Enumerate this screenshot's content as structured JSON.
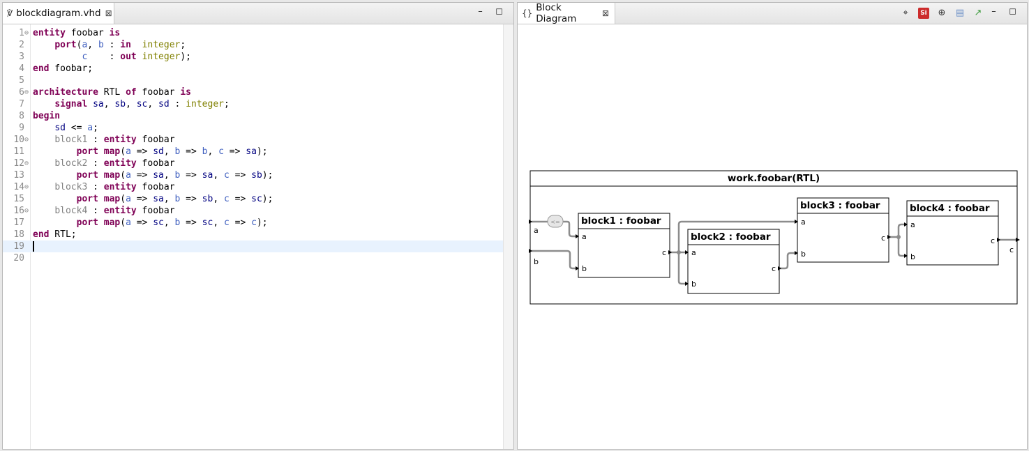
{
  "editor": {
    "tab_title": "blockdiagram.vhd",
    "code_lines": [
      {
        "n": "1",
        "fold": true,
        "parts": [
          [
            "kw",
            "entity"
          ],
          [
            "t",
            " foobar "
          ],
          [
            "kw",
            "is"
          ]
        ]
      },
      {
        "n": "2",
        "parts": [
          [
            "t",
            "    "
          ],
          [
            "kw",
            "port"
          ],
          [
            "t",
            "("
          ],
          [
            "prt",
            "a"
          ],
          [
            "t",
            ", "
          ],
          [
            "prt",
            "b"
          ],
          [
            "t",
            " : "
          ],
          [
            "kw",
            "in"
          ],
          [
            "t",
            "  "
          ],
          [
            "typ",
            "integer"
          ],
          [
            "t",
            ";"
          ]
        ]
      },
      {
        "n": "3",
        "parts": [
          [
            "t",
            "         "
          ],
          [
            "prt",
            "c"
          ],
          [
            "t",
            "    : "
          ],
          [
            "kw",
            "out"
          ],
          [
            "t",
            " "
          ],
          [
            "typ",
            "integer"
          ],
          [
            "t",
            ");"
          ]
        ]
      },
      {
        "n": "4",
        "parts": [
          [
            "kw",
            "end"
          ],
          [
            "t",
            " foobar;"
          ]
        ]
      },
      {
        "n": "5",
        "parts": []
      },
      {
        "n": "6",
        "fold": true,
        "parts": [
          [
            "kw",
            "architecture"
          ],
          [
            "t",
            " RTL "
          ],
          [
            "kw",
            "of"
          ],
          [
            "t",
            " foobar "
          ],
          [
            "kw",
            "is"
          ]
        ]
      },
      {
        "n": "7",
        "parts": [
          [
            "t",
            "    "
          ],
          [
            "kw",
            "signal"
          ],
          [
            "t",
            " "
          ],
          [
            "sig",
            "sa"
          ],
          [
            "t",
            ", "
          ],
          [
            "sig",
            "sb"
          ],
          [
            "t",
            ", "
          ],
          [
            "sig",
            "sc"
          ],
          [
            "t",
            ", "
          ],
          [
            "sig",
            "sd"
          ],
          [
            "t",
            " : "
          ],
          [
            "typ",
            "integer"
          ],
          [
            "t",
            ";"
          ]
        ]
      },
      {
        "n": "8",
        "parts": [
          [
            "kw",
            "begin"
          ]
        ]
      },
      {
        "n": "9",
        "parts": [
          [
            "t",
            "    "
          ],
          [
            "sig",
            "sd"
          ],
          [
            "t",
            " <= "
          ],
          [
            "prt",
            "a"
          ],
          [
            "t",
            ";"
          ]
        ]
      },
      {
        "n": "10",
        "fold": true,
        "parts": [
          [
            "t",
            "    "
          ],
          [
            "inst",
            "block1"
          ],
          [
            "t",
            " : "
          ],
          [
            "kw",
            "entity"
          ],
          [
            "t",
            " foobar"
          ]
        ]
      },
      {
        "n": "11",
        "parts": [
          [
            "t",
            "        "
          ],
          [
            "kw",
            "port map"
          ],
          [
            "t",
            "("
          ],
          [
            "prt",
            "a"
          ],
          [
            "t",
            " => "
          ],
          [
            "sig",
            "sd"
          ],
          [
            "t",
            ", "
          ],
          [
            "prt",
            "b"
          ],
          [
            "t",
            " => "
          ],
          [
            "prt",
            "b"
          ],
          [
            "t",
            ", "
          ],
          [
            "prt",
            "c"
          ],
          [
            "t",
            " => "
          ],
          [
            "sig",
            "sa"
          ],
          [
            "t",
            ");"
          ]
        ]
      },
      {
        "n": "12",
        "fold": true,
        "parts": [
          [
            "t",
            "    "
          ],
          [
            "inst",
            "block2"
          ],
          [
            "t",
            " : "
          ],
          [
            "kw",
            "entity"
          ],
          [
            "t",
            " foobar"
          ]
        ]
      },
      {
        "n": "13",
        "parts": [
          [
            "t",
            "        "
          ],
          [
            "kw",
            "port map"
          ],
          [
            "t",
            "("
          ],
          [
            "prt",
            "a"
          ],
          [
            "t",
            " => "
          ],
          [
            "sig",
            "sa"
          ],
          [
            "t",
            ", "
          ],
          [
            "prt",
            "b"
          ],
          [
            "t",
            " => "
          ],
          [
            "sig",
            "sa"
          ],
          [
            "t",
            ", "
          ],
          [
            "prt",
            "c"
          ],
          [
            "t",
            " => "
          ],
          [
            "sig",
            "sb"
          ],
          [
            "t",
            ");"
          ]
        ]
      },
      {
        "n": "14",
        "fold": true,
        "parts": [
          [
            "t",
            "    "
          ],
          [
            "inst",
            "block3"
          ],
          [
            "t",
            " : "
          ],
          [
            "kw",
            "entity"
          ],
          [
            "t",
            " foobar"
          ]
        ]
      },
      {
        "n": "15",
        "parts": [
          [
            "t",
            "        "
          ],
          [
            "kw",
            "port map"
          ],
          [
            "t",
            "("
          ],
          [
            "prt",
            "a"
          ],
          [
            "t",
            " => "
          ],
          [
            "sig",
            "sa"
          ],
          [
            "t",
            ", "
          ],
          [
            "prt",
            "b"
          ],
          [
            "t",
            " => "
          ],
          [
            "sig",
            "sb"
          ],
          [
            "t",
            ", "
          ],
          [
            "prt",
            "c"
          ],
          [
            "t",
            " => "
          ],
          [
            "sig",
            "sc"
          ],
          [
            "t",
            ");"
          ]
        ]
      },
      {
        "n": "16",
        "fold": true,
        "parts": [
          [
            "t",
            "    "
          ],
          [
            "inst",
            "block4"
          ],
          [
            "t",
            " : "
          ],
          [
            "kw",
            "entity"
          ],
          [
            "t",
            " foobar"
          ]
        ]
      },
      {
        "n": "17",
        "parts": [
          [
            "t",
            "        "
          ],
          [
            "kw",
            "port map"
          ],
          [
            "t",
            "("
          ],
          [
            "prt",
            "a"
          ],
          [
            "t",
            " => "
          ],
          [
            "sig",
            "sc"
          ],
          [
            "t",
            ", "
          ],
          [
            "prt",
            "b"
          ],
          [
            "t",
            " => "
          ],
          [
            "sig",
            "sc"
          ],
          [
            "t",
            ", "
          ],
          [
            "prt",
            "c"
          ],
          [
            "t",
            " => "
          ],
          [
            "prt",
            "c"
          ],
          [
            "t",
            ");"
          ]
        ]
      },
      {
        "n": "18",
        "parts": [
          [
            "kw",
            "end"
          ],
          [
            "t",
            " RTL;"
          ]
        ]
      },
      {
        "n": "19",
        "parts": [],
        "current": true
      },
      {
        "n": "20",
        "parts": []
      }
    ]
  },
  "diagram": {
    "tab_title": "Block Diagram",
    "toolbar_icons": [
      "fit-icon",
      "sirius-icon",
      "zoom-icon",
      "save-icon",
      "export-icon"
    ],
    "si_label": "Si",
    "title": "work.foobar(RTL)",
    "assign_label": "<=",
    "ports": {
      "a": "a",
      "b": "b",
      "c": "c"
    },
    "blocks": [
      {
        "label": "block1 : foobar"
      },
      {
        "label": "block2 : foobar"
      },
      {
        "label": "block3 : foobar"
      },
      {
        "label": "block4 : foobar"
      }
    ]
  },
  "colors": {
    "keyword": "#7f0055",
    "type": "#808000",
    "port": "#3f5fbf",
    "signal": "#000080",
    "wire": "#8c8c8c"
  }
}
